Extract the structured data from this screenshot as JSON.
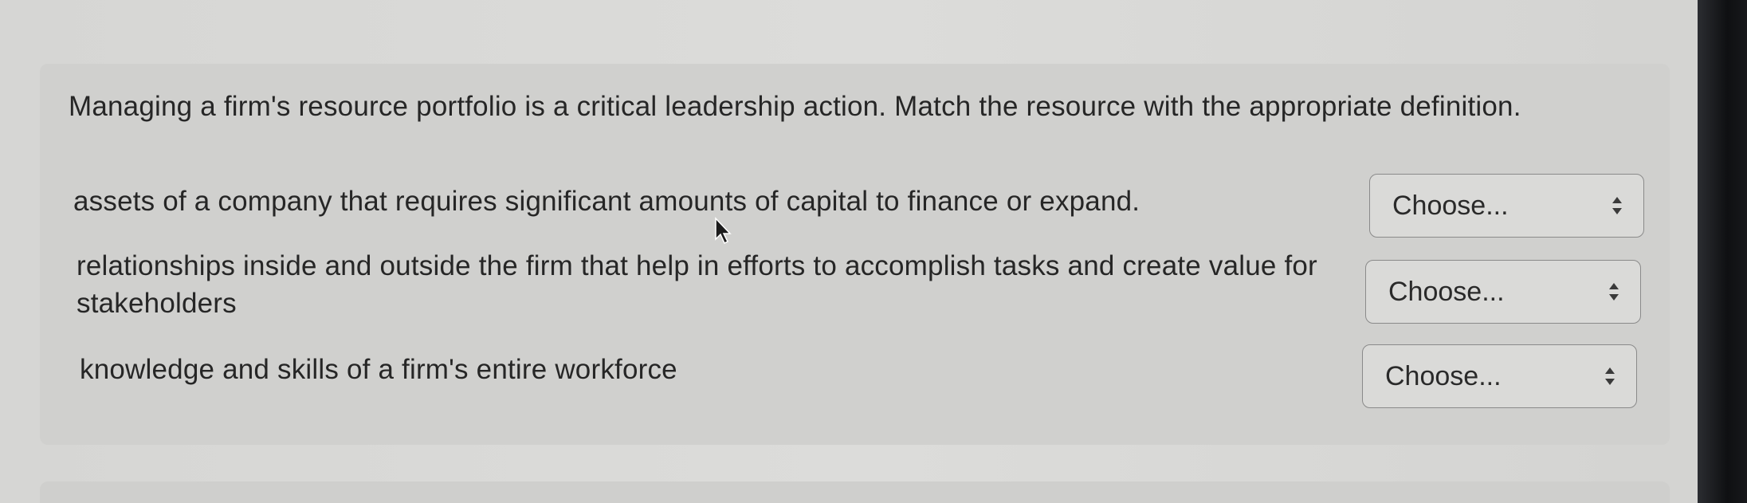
{
  "question": {
    "prompt": "Managing a firm's resource portfolio is a critical leadership action. Match the resource with the appropriate definition."
  },
  "rows": [
    {
      "definition": "assets of a company that requires significant amounts of capital to finance or expand.",
      "select_value": "Choose..."
    },
    {
      "definition": "relationships inside and outside the firm that help in efforts to accomplish tasks and create value for stakeholders",
      "select_value": "Choose..."
    },
    {
      "definition": "knowledge and skills of a firm's entire workforce",
      "select_value": "Choose..."
    }
  ],
  "icons": {
    "select_arrows": "up-down-arrows-icon",
    "pointer": "mouse-cursor-icon"
  },
  "colors": {
    "text": "#262626",
    "select_border": "#8a8a8a",
    "panel": "#d0d0ce",
    "bezel": "#111214"
  }
}
